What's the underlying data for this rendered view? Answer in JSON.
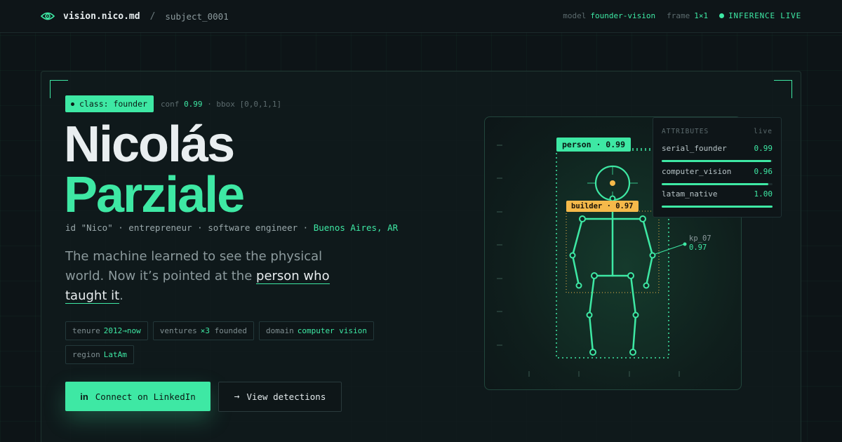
{
  "topbar": {
    "brand": "vision.nico.md",
    "separator": "/",
    "subject": "subject_0001",
    "model_key": "model",
    "model_value": "founder-vision",
    "frame_key": "frame",
    "frame_value": "1×1",
    "status": "INFERENCE LIVE"
  },
  "hero": {
    "class_badge": "class: founder",
    "conf_key": "conf",
    "conf_value": "0.99",
    "bbox_text": "· bbox [0,0,1,1]",
    "first_name": "Nicolás",
    "last_name": "Parziale",
    "id_line": "id \"Nico\" · entrepreneur · software engineer ·",
    "location": "Buenos Aires, AR",
    "tagline_part1": "The machine learned to see the physical world. Now it’s pointed at the ",
    "tagline_highlight": "person who taught it",
    "tagline_end": ".",
    "chips": [
      {
        "key": "tenure",
        "value": "2012→now",
        "suffix": ""
      },
      {
        "key": "ventures",
        "value": "×3",
        "suffix": "founded"
      },
      {
        "key": "domain",
        "value": "computer vision",
        "suffix": ""
      },
      {
        "key": "region",
        "value": "LatAm",
        "suffix": ""
      }
    ],
    "primary_button": "Connect on LinkedIn",
    "primary_icon": "in",
    "secondary_button": "View detections",
    "secondary_icon": "→"
  },
  "detection": {
    "person_label": "person · 0.99",
    "builder_label": "builder · 0.97",
    "keypoint_name": "kp_07",
    "keypoint_conf": "0.97"
  },
  "attributes": {
    "title": "ATTRIBUTES",
    "status": "live",
    "items": [
      {
        "name": "serial_founder",
        "value": "0.99",
        "level": 0.99
      },
      {
        "name": "computer_vision",
        "value": "0.96",
        "level": 0.96
      },
      {
        "name": "latam_native",
        "value": "1.00",
        "level": 1.0
      }
    ]
  },
  "colors": {
    "accent": "#3ee8a4",
    "warning": "#f5b94a",
    "background": "#0d1417"
  }
}
